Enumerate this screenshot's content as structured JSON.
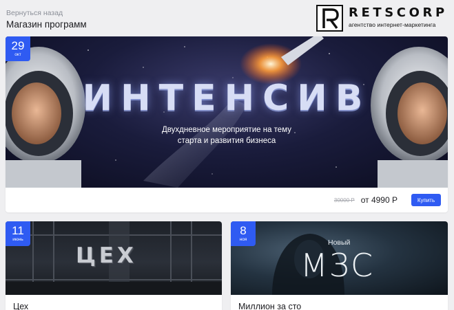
{
  "header": {
    "back_label": "Вернуться назад",
    "page_title": "Магазин программ"
  },
  "logo": {
    "letter": "R",
    "name": "RETSCORP",
    "tagline": "агентство интернет-маркетинга"
  },
  "colors": {
    "accent": "#2f5bf2",
    "page_background": "#efeff1",
    "card_background": "#ffffff"
  },
  "featured": {
    "date_day": "29",
    "date_month": "окт",
    "banner_title": "ИНТЕНСИВ",
    "banner_subtitle_line1": "Двухдневное мероприятие на тему",
    "banner_subtitle_line2": "старта и развития бизнеса",
    "price_old": "30000 Р",
    "price_new": "от 4990 Р",
    "buy_label": "Купить"
  },
  "programs": [
    {
      "date_day": "11",
      "date_month": "июнь",
      "banner_text": "ЦЕХ",
      "title": "Цех"
    },
    {
      "date_day": "8",
      "date_month": "ноя",
      "banner_small_text": "Новый",
      "banner_text": "МЗС",
      "title": "Миллион за сто"
    }
  ]
}
